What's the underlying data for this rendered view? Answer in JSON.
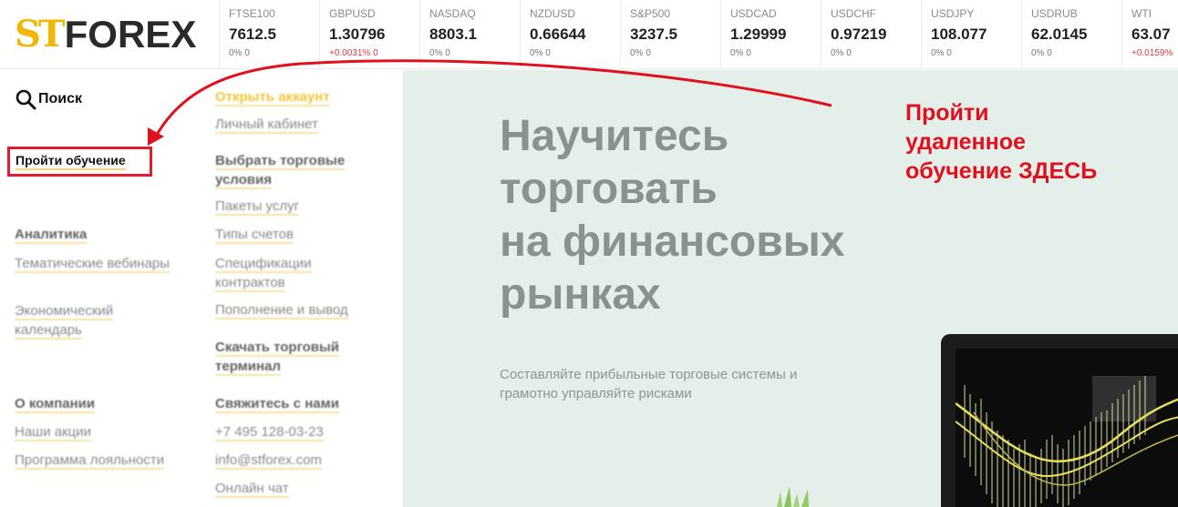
{
  "logo": {
    "part1": "ST",
    "part2": "FOREX"
  },
  "tickers": [
    {
      "symbol": "FTSE100",
      "price": "7612.5",
      "change": "0% 0",
      "up": false
    },
    {
      "symbol": "GBPUSD",
      "price": "1.30796",
      "change": "+0.0031% 0",
      "up": true
    },
    {
      "symbol": "NASDAQ",
      "price": "8803.1",
      "change": "0% 0",
      "up": false
    },
    {
      "symbol": "NZDUSD",
      "price": "0.66644",
      "change": "0% 0",
      "up": false
    },
    {
      "symbol": "S&P500",
      "price": "3237.5",
      "change": "0% 0",
      "up": false
    },
    {
      "symbol": "USDCAD",
      "price": "1.29999",
      "change": "0% 0",
      "up": false
    },
    {
      "symbol": "USDCHF",
      "price": "0.97219",
      "change": "0% 0",
      "up": false
    },
    {
      "symbol": "USDJPY",
      "price": "108.077",
      "change": "0% 0",
      "up": false
    },
    {
      "symbol": "USDRUB",
      "price": "62.0145",
      "change": "0% 0",
      "up": false
    },
    {
      "symbol": "WTI",
      "price": "63.07",
      "change": "+0.0159%",
      "up": true
    }
  ],
  "menu": {
    "search_label": "Поиск",
    "learn_label": "Пройти обучение",
    "col1": {
      "analytics_head": "Аналитика",
      "webinars": "Тематические вебинары",
      "calendar": "Экономический календарь",
      "company_head": "О компании",
      "promos": "Наши акции",
      "loyalty": "Программа лояльности"
    },
    "col2": {
      "open_account": "Открыть аккаунт",
      "cabinet": "Личный кабинет",
      "choose_head": "Выбрать торговые условия",
      "packages": "Пакеты услуг",
      "account_types": "Типы счетов",
      "specs": "Спецификации контрактов",
      "deposit": "Пополнение и вывод",
      "download_head": "Скачать торговый терминал",
      "contact_head": "Свяжитесь с нами",
      "phone": "+7 495 128-03-23",
      "email": "info@stforex.com",
      "chat": "Онлайн чат"
    }
  },
  "hero": {
    "title_lines": [
      "Научитесь",
      "торговать",
      "на финансовых",
      "рынках"
    ],
    "subtitle": "Составляйте прибыльные торговые системы и грамотно управляйте рисками"
  },
  "annotation": {
    "lines": [
      "Пройти",
      "удаленное",
      "обучение ЗДЕСЬ"
    ],
    "color": "#e0101e"
  },
  "colors": {
    "brand_yellow": "#f2b705",
    "hero_bg": "#e4efe9",
    "up_red": "#d43a4a"
  }
}
